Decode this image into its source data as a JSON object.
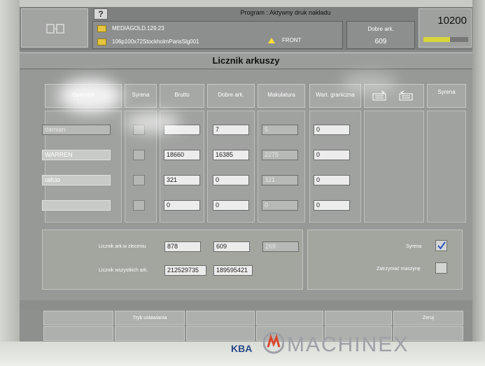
{
  "header": {
    "help_label": "?",
    "program_title": "Program :  Aktywny druk nakładu",
    "job_lines": [
      "MEDIAGOLD.129.23",
      "106p100x72StockholmParisSlg001"
    ],
    "front_label": "FRONT",
    "good_sheets_label": "Dobre ark.",
    "good_sheets_value": "609",
    "speed_value": "10200"
  },
  "page_title": "Licznik arkuszy",
  "columns": {
    "operator": "Operator",
    "syrena": "Syrena",
    "brutto": "Brutto",
    "dobre": "Dobre ark.",
    "makulatura": "Makulatura",
    "wart_graniczna": "Wart. graniczna",
    "syrena2": "Syrena"
  },
  "rows": [
    {
      "name": "damian",
      "brutto": "",
      "dobre": "7",
      "makulatura": "5",
      "limit": "0"
    },
    {
      "name": "WARREN",
      "brutto": "18660",
      "dobre": "16385",
      "makulatura": "2275",
      "limit": "0"
    },
    {
      "name": "rafcio",
      "brutto": "321",
      "dobre": "0",
      "makulatura": "321",
      "limit": "0"
    },
    {
      "name": "",
      "brutto": "0",
      "dobre": "0",
      "makulatura": "0",
      "limit": "0"
    }
  ],
  "summary": {
    "order_label": "Licznik ark.w zleceniu",
    "order_brutto": "878",
    "order_good": "609",
    "order_waste": "269",
    "total_label": "Licznik wszystkich ark.",
    "total_brutto": "212529735",
    "total_good": "189595421"
  },
  "options": {
    "siren_label": "Syrena",
    "stop_label": "Zatrzymać maszynę"
  },
  "softkeys": {
    "row1": [
      "",
      "Tryb ustawiania",
      "",
      "",
      "",
      "Zeruj"
    ],
    "row2": [
      "",
      "",
      "",
      "",
      "",
      ""
    ]
  },
  "watermark": {
    "brand": "MACHINEX",
    "maker": "KBA"
  }
}
